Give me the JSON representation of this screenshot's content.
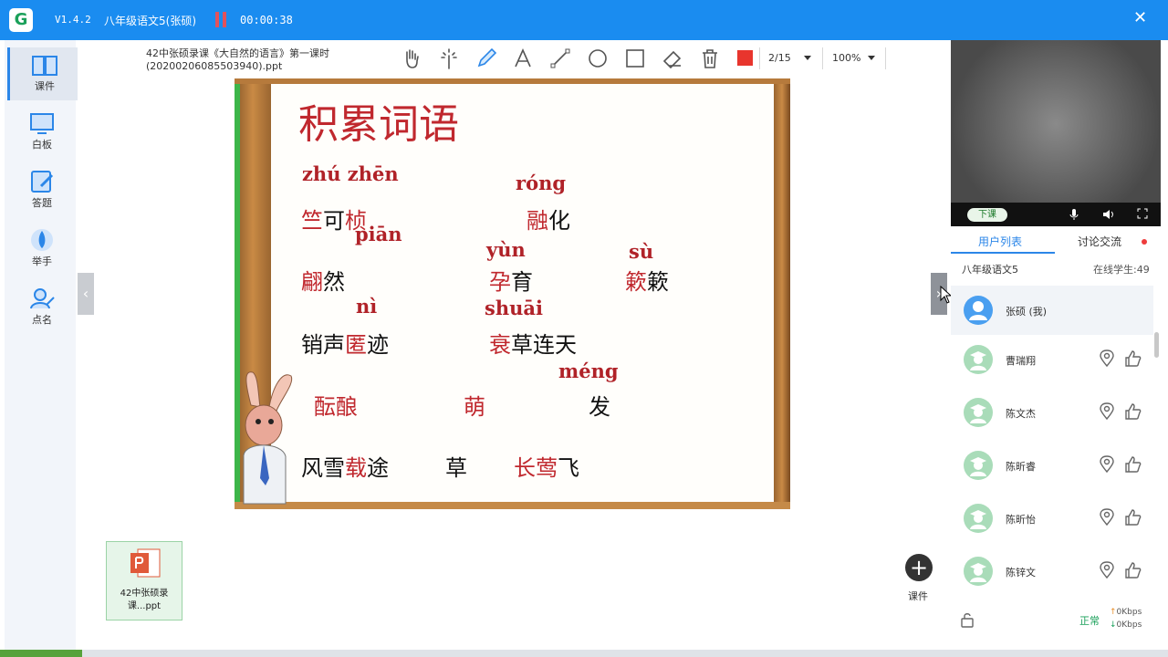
{
  "titlebar": {
    "logo_letter": "G",
    "version": "V1.4.2",
    "class_title": "八年级语文5(张硕)",
    "timer": "00:00:38",
    "close": "✕"
  },
  "sidebar": {
    "items": [
      {
        "label": "课件",
        "icon": "book-icon"
      },
      {
        "label": "白板",
        "icon": "whiteboard-icon"
      },
      {
        "label": "答题",
        "icon": "answer-icon"
      },
      {
        "label": "举手",
        "icon": "raise-hand-icon"
      },
      {
        "label": "点名",
        "icon": "roll-call-icon"
      }
    ]
  },
  "toolbar": {
    "doc_name": "42中张硕录课《大自然的语言》第一课时(20200206085503940).ppt",
    "page": "2/15",
    "zoom": "100%",
    "pen_color": "#e8352d"
  },
  "slide": {
    "title": "积累词语",
    "pinyin": [
      "zhú zhēn",
      "róng",
      "piān",
      "yùn",
      "sù",
      "nì",
      "shuāi",
      "méng"
    ],
    "words": {
      "w1_red": "竺",
      "w1_black": "可",
      "w1_red2": "桢",
      "w2_red": "融",
      "w2_black": "化",
      "w3_red": "翩",
      "w3_black": "然",
      "w4_red": "孕",
      "w4_black": "育",
      "w5_red": "簌",
      "w5_black": "簌",
      "w6_a": "销声",
      "w6_red": "匿",
      "w6_b": "迹",
      "w7_red": "衰",
      "w7_black": "草连天",
      "w8_red": "酝酿",
      "w9_red": "萌",
      "w9_black": "发",
      "w10_a": "风雪",
      "w10_red": "载",
      "w10_b": "途",
      "w11": "草",
      "w12_red": "长莺",
      "w12_black": "飞"
    }
  },
  "thumbnail": {
    "name": "42中张硕录课...ppt"
  },
  "add_courseware_label": "课件",
  "video": {
    "end_class": "下课"
  },
  "panel": {
    "tab_users": "用户列表",
    "tab_chat": "讨论交流",
    "class_name": "八年级语文5",
    "online_count": "在线学生:49",
    "users": [
      {
        "name": "张硕 (我)"
      },
      {
        "name": "曹瑞翔"
      },
      {
        "name": "陈文杰"
      },
      {
        "name": "陈昕睿"
      },
      {
        "name": "陈昕怡"
      },
      {
        "name": "陈锌文"
      }
    ],
    "status": "正常",
    "up_speed": "0Kbps",
    "down_speed": "0Kbps"
  }
}
